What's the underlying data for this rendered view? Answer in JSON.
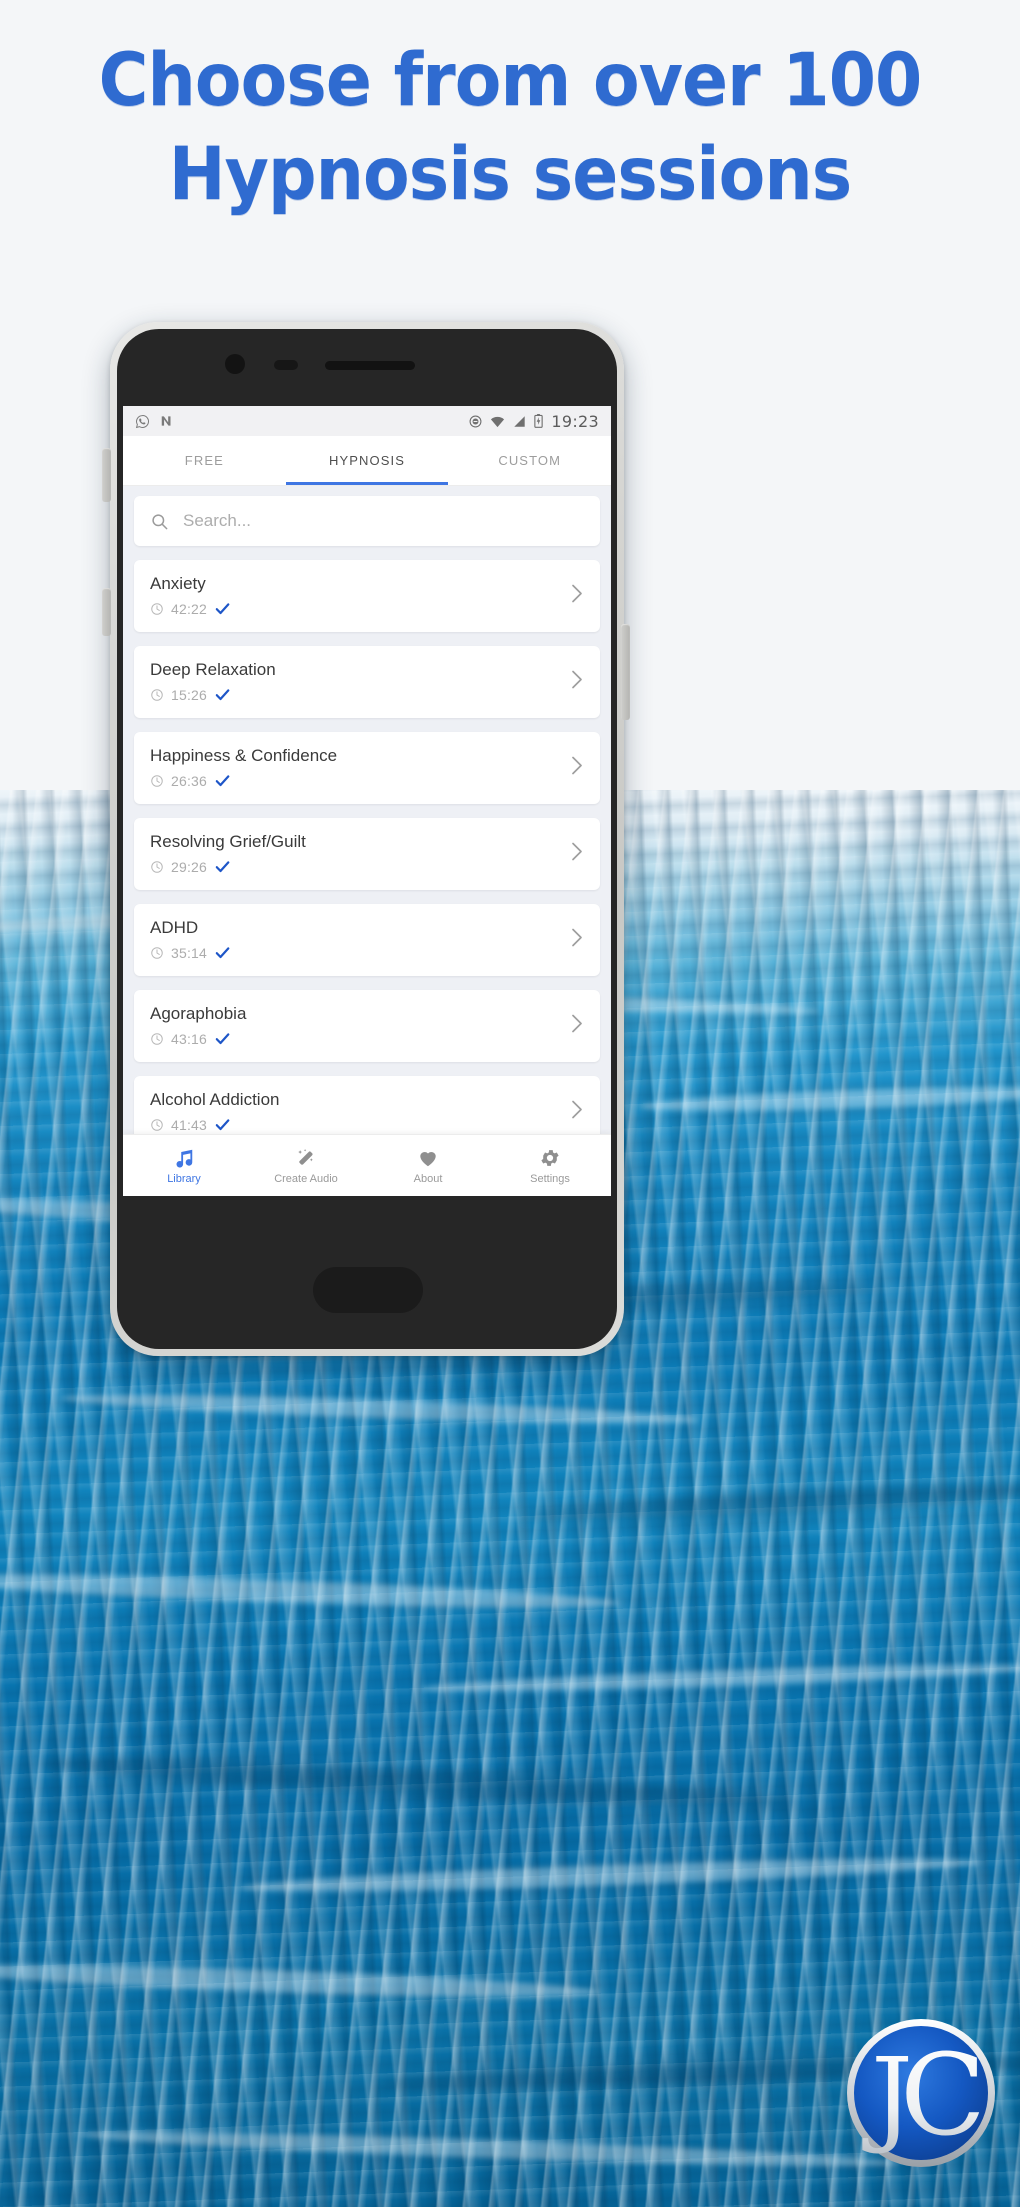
{
  "headline": {
    "line1": "Choose from over 100",
    "line2": "Hypnosis sessions",
    "color": "#2f6bd0"
  },
  "phone": {
    "status_bar": {
      "left_icons": [
        "whatsapp-icon",
        "nova-launcher-icon"
      ],
      "right_icons": [
        "do-not-disturb-icon",
        "wifi-icon",
        "cellular-signal-icon",
        "battery-icon"
      ],
      "time": "19:23"
    },
    "tabs": [
      {
        "label": "FREE",
        "active": false
      },
      {
        "label": "HYPNOSIS",
        "active": true
      },
      {
        "label": "CUSTOM",
        "active": false
      }
    ],
    "search": {
      "placeholder": "Search...",
      "value": "",
      "icon": "search-icon"
    },
    "sessions": [
      {
        "title": "Anxiety",
        "duration": "42:22",
        "downloaded": true
      },
      {
        "title": "Deep Relaxation",
        "duration": "15:26",
        "downloaded": true
      },
      {
        "title": "Happiness & Confidence",
        "duration": "26:36",
        "downloaded": true
      },
      {
        "title": "Resolving Grief/Guilt",
        "duration": "29:26",
        "downloaded": true
      },
      {
        "title": "ADHD",
        "duration": "35:14",
        "downloaded": true
      },
      {
        "title": "Agoraphobia",
        "duration": "43:16",
        "downloaded": true
      },
      {
        "title": "Alcohol Addiction",
        "duration": "41:43",
        "downloaded": true
      }
    ],
    "bottom_nav": [
      {
        "label": "Library",
        "icon": "music-note-icon",
        "active": true
      },
      {
        "label": "Create Audio",
        "icon": "magic-wand-icon",
        "active": false
      },
      {
        "label": "About",
        "icon": "heart-icon",
        "active": false
      },
      {
        "label": "Settings",
        "icon": "gear-icon",
        "active": false
      }
    ],
    "accent_color": "#3f76e3",
    "checkmark_color": "#1e56c8"
  },
  "logo": {
    "text": "JC",
    "circle_color": "#1558c0"
  }
}
